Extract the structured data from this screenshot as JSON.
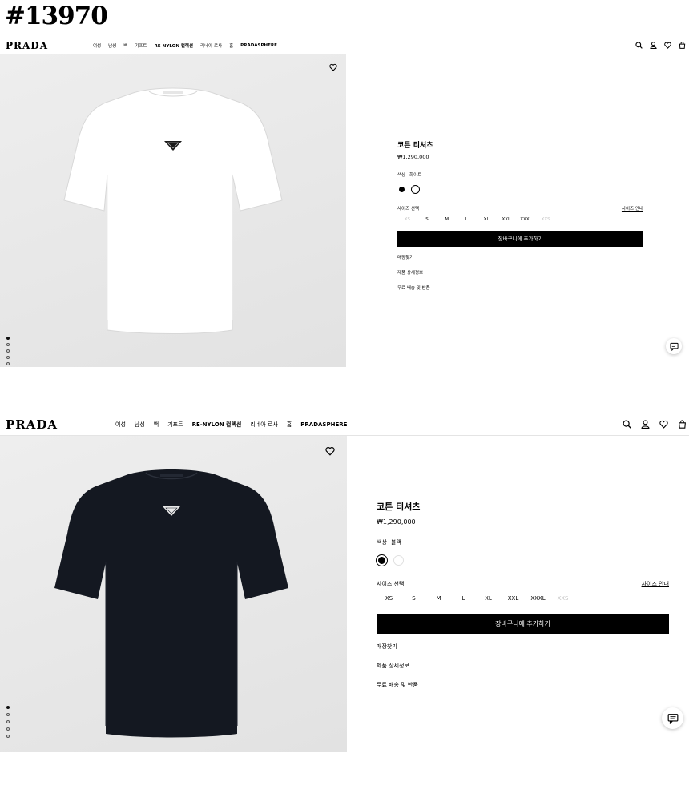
{
  "code_label": "#13970",
  "screens": [
    {
      "logo": "PRADA",
      "nav": [
        {
          "label": "여성",
          "en": false
        },
        {
          "label": "남성",
          "en": false
        },
        {
          "label": "백",
          "en": false
        },
        {
          "label": "기프트",
          "en": false
        },
        {
          "label": "RE-NYLON 컬렉션",
          "en": true
        },
        {
          "label": "리네아 로사",
          "en": false
        },
        {
          "label": "홈",
          "en": false
        },
        {
          "label": "PRADASPHERE",
          "en": true
        }
      ],
      "header_icons": [
        "search-icon",
        "account-icon",
        "heart-icon",
        "bag-icon"
      ],
      "product": {
        "title": "코튼 티셔츠",
        "price": "₩1,290,000",
        "color_label": "색상",
        "color_value": "화이트",
        "swatches": [
          "black",
          "white"
        ],
        "size_label": "사이즈 선택",
        "size_guide": "사이즈 안내",
        "sizes": [
          {
            "label": "XS",
            "available": false
          },
          {
            "label": "S",
            "available": true
          },
          {
            "label": "M",
            "available": true
          },
          {
            "label": "L",
            "available": true
          },
          {
            "label": "XL",
            "available": true
          },
          {
            "label": "XXL",
            "available": true
          },
          {
            "label": "XXXL",
            "available": true
          },
          {
            "label": "XXS",
            "available": false
          }
        ],
        "add_to_cart": "장바구니에 추가하기",
        "links": [
          "매장찾기",
          "제품 상세정보",
          "무료 배송 및 반품"
        ]
      },
      "image_dots": 5,
      "active_dot": 0,
      "shirt_color": "#ffffff"
    },
    {
      "logo": "PRADA",
      "nav": [
        {
          "label": "여성",
          "en": false
        },
        {
          "label": "남성",
          "en": false
        },
        {
          "label": "백",
          "en": false
        },
        {
          "label": "기프트",
          "en": false
        },
        {
          "label": "RE-NYLON 컬렉션",
          "en": true
        },
        {
          "label": "리네아 로사",
          "en": false
        },
        {
          "label": "홈",
          "en": false
        },
        {
          "label": "PRADASPHERE",
          "en": true
        }
      ],
      "header_icons": [
        "search-icon",
        "account-icon",
        "heart-icon",
        "bag-icon"
      ],
      "product": {
        "title": "코튼 티셔츠",
        "price": "₩1,290,000",
        "color_label": "색상",
        "color_value": "블랙",
        "swatches": [
          "black",
          "white"
        ],
        "size_label": "사이즈 선택",
        "size_guide": "사이즈 안내",
        "sizes": [
          {
            "label": "XS",
            "available": true
          },
          {
            "label": "S",
            "available": true
          },
          {
            "label": "M",
            "available": true
          },
          {
            "label": "L",
            "available": true
          },
          {
            "label": "XL",
            "available": true
          },
          {
            "label": "XXL",
            "available": true
          },
          {
            "label": "XXXL",
            "available": true
          },
          {
            "label": "XXS",
            "available": false
          }
        ],
        "add_to_cart": "장바구니에 추가하기",
        "links": [
          "매장찾기",
          "제품 상세정보",
          "무료 배송 및 반품"
        ]
      },
      "image_dots": 5,
      "active_dot": 0,
      "shirt_color": "#141821"
    }
  ]
}
